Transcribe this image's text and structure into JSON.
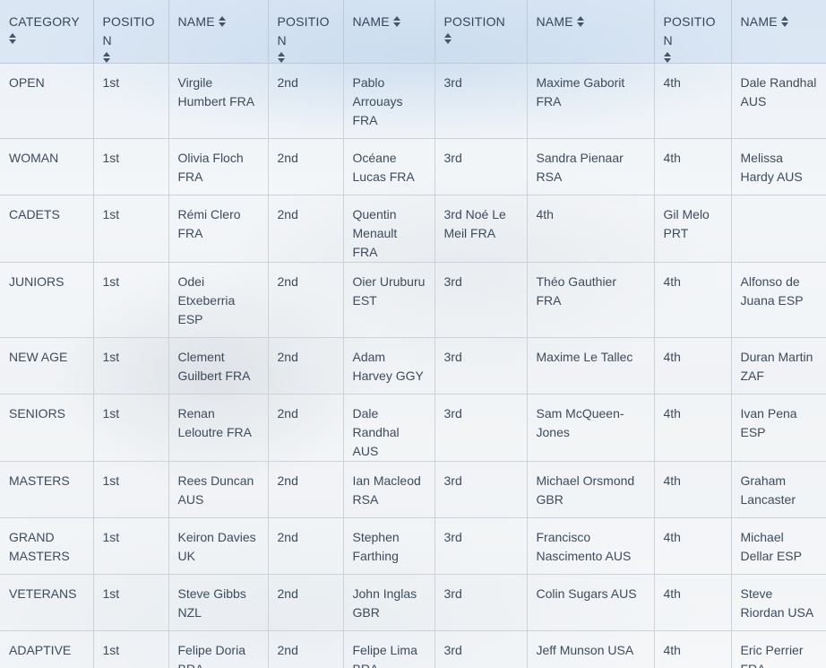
{
  "headers": [
    {
      "label": "CATEGORY",
      "name": "category"
    },
    {
      "label": "POSITION",
      "name": "position-1"
    },
    {
      "label": "NAME",
      "name": "name-1"
    },
    {
      "label": "POSITION",
      "name": "position-2"
    },
    {
      "label": "NAME",
      "name": "name-2"
    },
    {
      "label": "POSITION",
      "name": "position-3"
    },
    {
      "label": "NAME",
      "name": "name-3"
    },
    {
      "label": "POSITION",
      "name": "position-4"
    },
    {
      "label": "NAME",
      "name": "name-4"
    }
  ],
  "rows": [
    [
      "OPEN",
      "1st",
      "Virgile Humbert FRA",
      "2nd",
      "Pablo Arrouays FRA",
      "3rd",
      "Maxime Gaborit FRA",
      "4th",
      "Dale Randhal AUS"
    ],
    [
      "WOMAN",
      "1st",
      "Olivia Floch FRA",
      "2nd",
      "Océane Lucas FRA",
      "3rd",
      "Sandra Pienaar RSA",
      "4th",
      "Melissa Hardy AUS"
    ],
    [
      "CADETS",
      "1st",
      "Rémi Clero FRA",
      "2nd",
      "Quentin Menault FRA",
      "3rd Noé Le Meil FRA",
      "4th",
      "Gil Melo PRT",
      ""
    ],
    [
      "JUNIORS",
      "1st",
      "Odei Etxeberria ESP",
      "2nd",
      "Oier Uruburu EST",
      "3rd",
      "Théo Gauthier FRA",
      "4th",
      "Alfonso de Juana ESP"
    ],
    [
      "NEW AGE",
      "1st",
      "Clement Guilbert FRA",
      "2nd",
      "Adam Harvey GGY",
      "3rd",
      "Maxime Le Tallec",
      "4th",
      "Duran Martin ZAF"
    ],
    [
      "SENIORS",
      "1st",
      "Renan Leloutre FRA",
      "2nd",
      "Dale Randhal AUS",
      "3rd",
      "Sam McQueen-Jones",
      "4th",
      "Ivan Pena ESP"
    ],
    [
      "MASTERS",
      "1st",
      "Rees Duncan AUS",
      "2nd",
      "Ian Macleod RSA",
      "3rd",
      "Michael Orsmond GBR",
      "4th",
      "Graham Lancaster"
    ],
    [
      "GRAND MASTERS",
      "1st",
      "Keiron Davies UK",
      "2nd",
      "Stephen Farthing",
      "3rd",
      "Francisco Nascimento AUS",
      "4th",
      "Michael Dellar ESP"
    ],
    [
      "VETERANS",
      "1st",
      "Steve Gibbs NZL",
      "2nd",
      "John Inglas GBR",
      "3rd",
      "Colin Sugars  AUS",
      "4th",
      "Steve Riordan  USA"
    ],
    [
      "ADAPTIVE",
      "1st",
      "Felipe Doria BRA",
      "2nd",
      "Felipe Lima BRA",
      "3rd",
      "Jeff Munson USA",
      "4th",
      "Eric Perrier FRA"
    ]
  ],
  "colors": {
    "header_bg": "#cddef0",
    "text": "#3c4b5c",
    "grid": "#c8d0da"
  },
  "icons": {
    "sort": "sort-arrows-icon"
  }
}
